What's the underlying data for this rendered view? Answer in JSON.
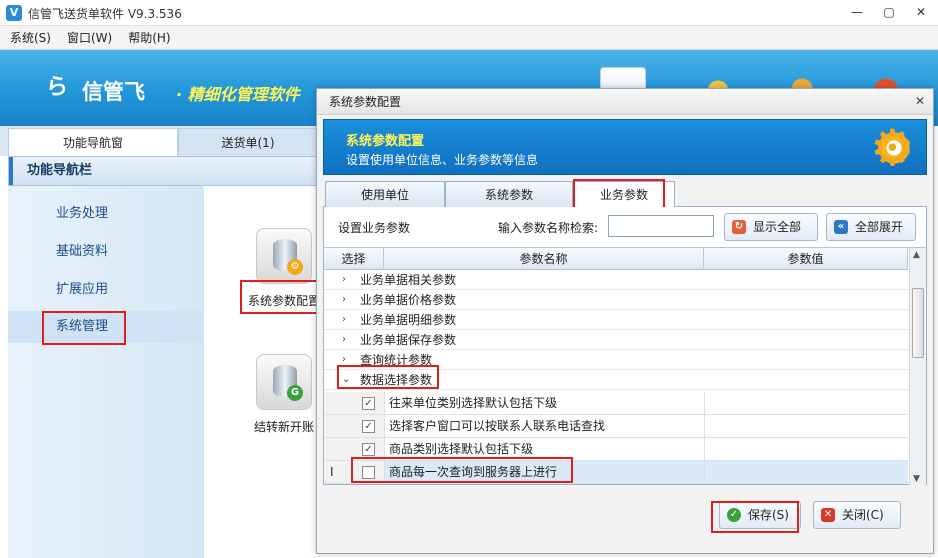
{
  "window": {
    "title": "信管飞送货单软件 V9.3.536",
    "logo_glyph": "V",
    "min": "—",
    "max": "▢",
    "close": "✕"
  },
  "menu": [
    {
      "label": "系统(S)"
    },
    {
      "label": "窗口(W)"
    },
    {
      "label": "帮助(H)"
    }
  ],
  "banner": {
    "logo_glyph": "ら",
    "brand": "信管飞",
    "slogan": "· 精细化管理软件"
  },
  "nav": {
    "tabs": [
      {
        "label": "功能导航窗"
      },
      {
        "label": "送货单(1)"
      }
    ],
    "header": "功能导航栏",
    "items": [
      {
        "label": "业务处理"
      },
      {
        "label": "基础资料"
      },
      {
        "label": "扩展应用"
      },
      {
        "label": "系统管理"
      }
    ]
  },
  "features": [
    {
      "label": "系统参数配置"
    },
    {
      "label": "结转新开账"
    }
  ],
  "dialog": {
    "title": "系统参数配置",
    "close": "✕",
    "header_title": "系统参数配置",
    "header_subtitle": "设置使用单位信息、业务参数等信息",
    "tabs": [
      {
        "label": "使用单位"
      },
      {
        "label": "系统参数"
      },
      {
        "label": "业务参数"
      }
    ],
    "search_label": "设置业务参数",
    "search_prompt": "输入参数名称检索:",
    "search_value": "",
    "btn_show_all": "显示全部",
    "btn_expand_all": "全部展开",
    "columns": [
      "选择",
      "参数名称",
      "参数值"
    ],
    "groups": [
      {
        "arrow": "›",
        "name": "业务单据相关参数"
      },
      {
        "arrow": "›",
        "name": "业务单据价格参数"
      },
      {
        "arrow": "›",
        "name": "业务单据明细参数"
      },
      {
        "arrow": "›",
        "name": "业务单据保存参数"
      },
      {
        "arrow": "›",
        "name": "查询统计参数"
      },
      {
        "arrow": "⌄",
        "name": "数据选择参数"
      }
    ],
    "params": [
      {
        "check": "✓",
        "name": "往来单位类别选择默认包括下级",
        "value": ""
      },
      {
        "check": "✓",
        "name": "选择客户窗口可以按联系人联系电话查找",
        "value": ""
      },
      {
        "check": "✓",
        "name": "商品类别选择默认包括下级",
        "value": ""
      },
      {
        "check": "",
        "name": "商品每一次查询到服务器上进行",
        "value": ""
      }
    ],
    "text_cursor": "I",
    "btn_save": "保存(S)",
    "btn_close": "关闭(C)"
  },
  "colors": {
    "accent": "#2196d8",
    "highlight": "#e01e1e",
    "slogan": "#fff45c"
  }
}
